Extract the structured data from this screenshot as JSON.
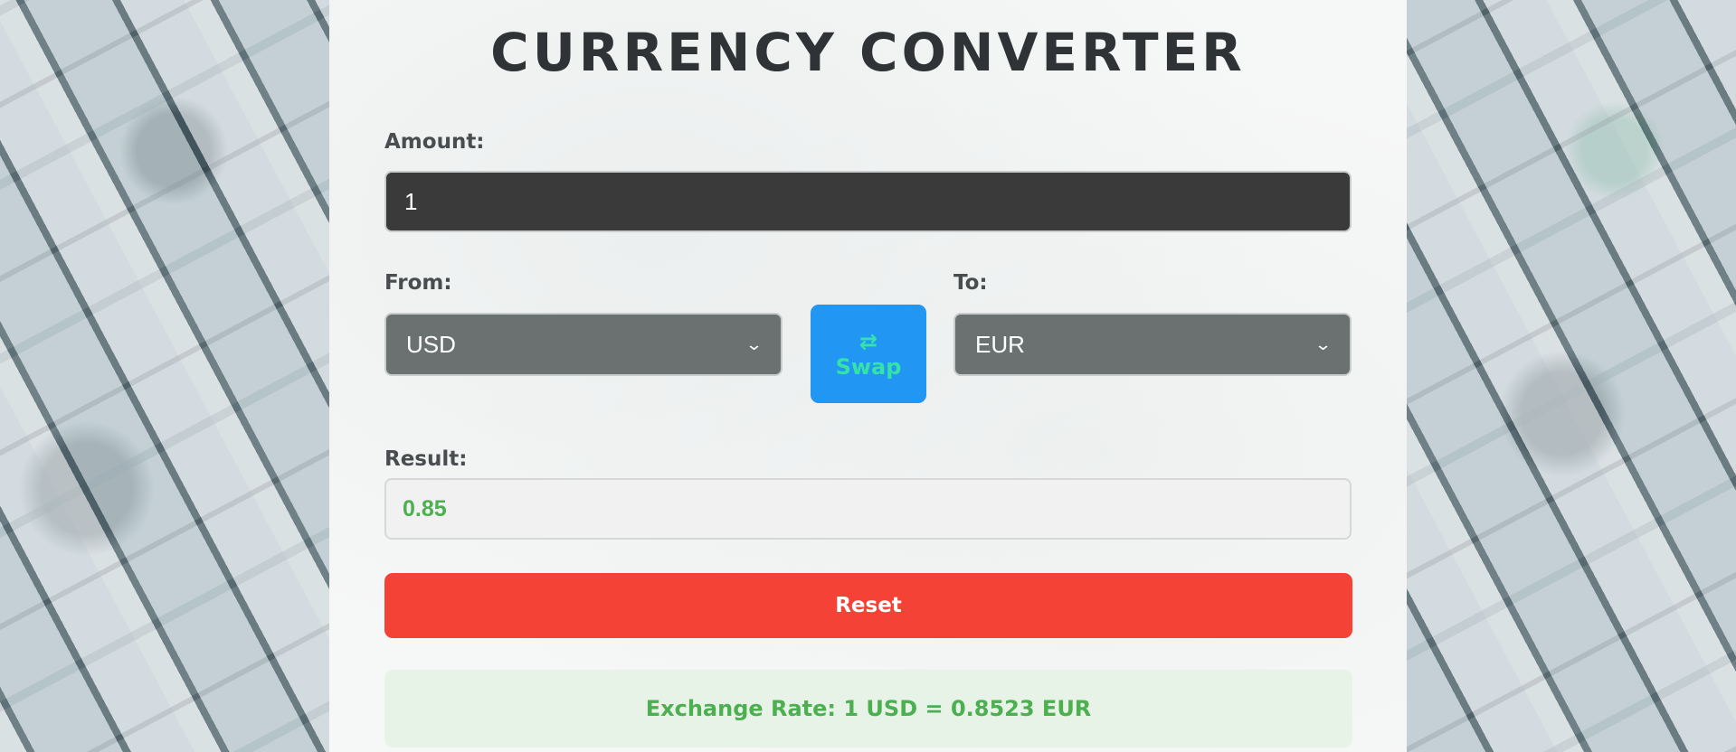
{
  "app": {
    "title": "CURRENCY CONVERTER"
  },
  "amount": {
    "label": "Amount:",
    "value": "1"
  },
  "from": {
    "label": "From:",
    "selected": "USD"
  },
  "to": {
    "label": "To:",
    "selected": "EUR"
  },
  "swap": {
    "icon": "⇄",
    "label": "Swap"
  },
  "result": {
    "label": "Result:",
    "value": "0.85"
  },
  "reset": {
    "label": "Reset"
  },
  "rate": {
    "text": "Exchange Rate: 1 USD = 0.8523 EUR"
  },
  "colors": {
    "swap_bg": "#2196f3",
    "swap_text": "#34e3a8",
    "reset_bg": "#f44336",
    "result_text": "#4caf50",
    "rate_bg": "#e8f3e7"
  }
}
